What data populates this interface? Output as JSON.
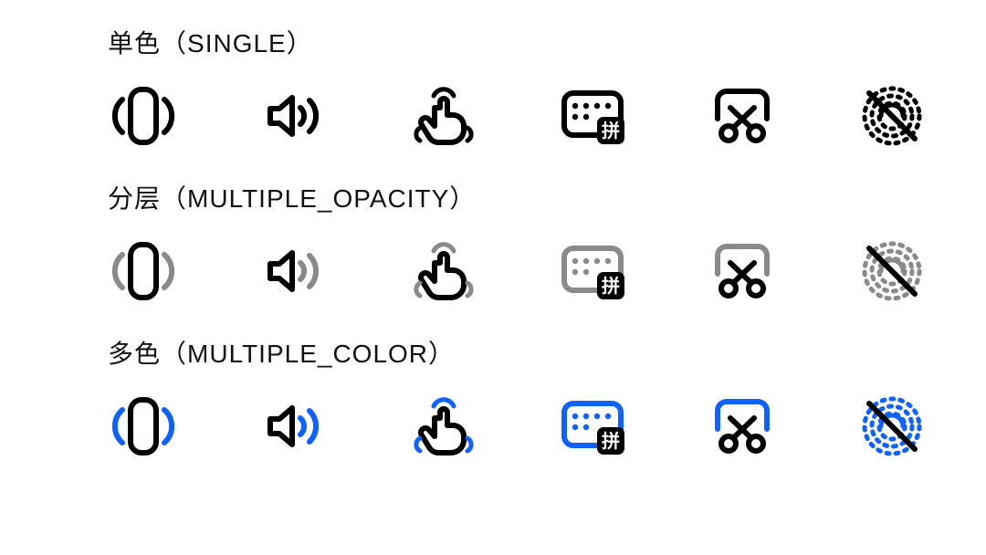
{
  "sections": [
    {
      "key": "single",
      "zh": "单色",
      "en": "SINGLE"
    },
    {
      "key": "opacity",
      "zh": "分层",
      "en": "MULTIPLE_OPACITY"
    },
    {
      "key": "color",
      "zh": "多色",
      "en": "MULTIPLE_COLOR"
    }
  ],
  "iconNames": [
    "phone-vibrate-icon",
    "volume-icon",
    "touch-gesture-icon",
    "keyboard-pinyin-icon",
    "screenshot-crop-icon",
    "fingerprint-off-icon"
  ],
  "keyboardBadge": "拼",
  "colors": {
    "primary": "#000000",
    "secondaryOpacity": "#8a8a8a",
    "accent": "#0F62FE"
  }
}
